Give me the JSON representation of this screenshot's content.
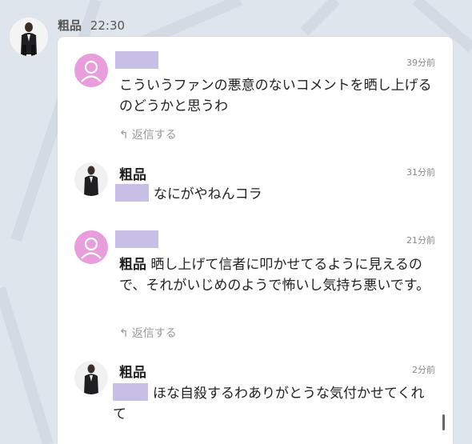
{
  "header": {
    "sender_name": "粗品",
    "time": "22:30"
  },
  "comments": [
    {
      "kind": "fan",
      "time": "39分前",
      "text": "こういうファンの悪意のないコメントを晒し上げるのどうかと思うわ",
      "reply_label": "返信する"
    },
    {
      "kind": "owner",
      "name": "粗品",
      "time": "31分前",
      "text": "なにがやねんコラ"
    },
    {
      "kind": "fan",
      "time": "21分前",
      "mention": "粗品",
      "text": "晒し上げて信者に叩かせてるように見えるので、それがいじめのようで怖いし気持ち悪いです。",
      "reply_label": "返信する"
    },
    {
      "kind": "owner",
      "name": "粗品",
      "time": "2分前",
      "text": "ほな自殺するわありがとうな気付かせてくれて"
    }
  ],
  "colors": {
    "background": "#dfe5ec",
    "card": "#ffffff",
    "redaction": "#c8bfe7",
    "fan_avatar": "#e89ddc",
    "muted_text": "#888888"
  },
  "icons": {
    "reply": "reply-arrow-icon",
    "fan_avatar": "default-person-icon"
  }
}
